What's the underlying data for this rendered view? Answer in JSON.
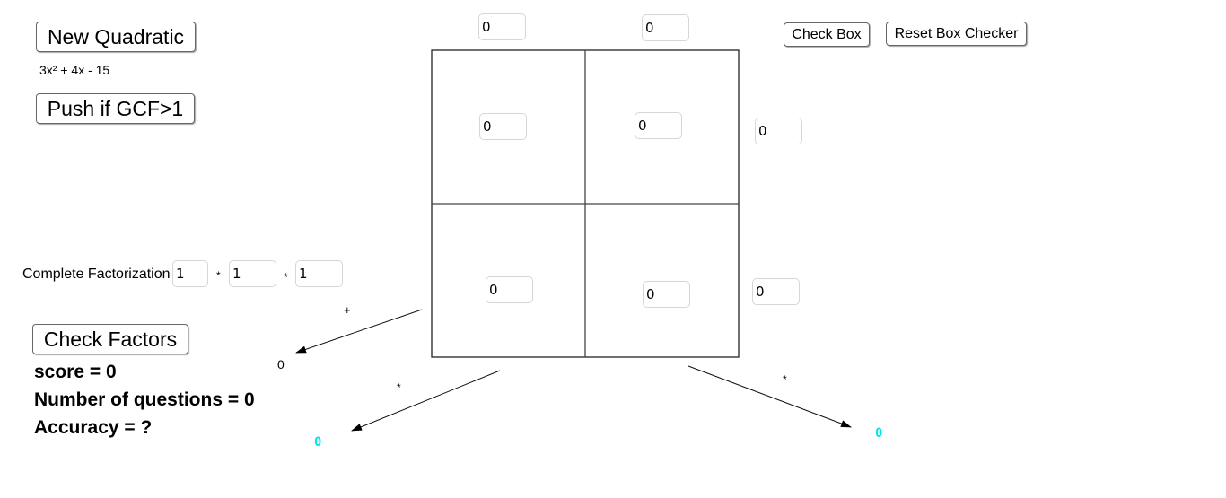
{
  "buttons": {
    "new_quadratic": "New Quadratic",
    "push_gcf": "Push if GCF>1",
    "check_box": "Check Box",
    "reset_box_checker": "Reset Box Checker",
    "check_factors": "Check Factors"
  },
  "quadratic": {
    "expression": "3x² + 4x - 15"
  },
  "box": {
    "top_factors": [
      "0",
      "0"
    ],
    "side_factors": [
      "0",
      "0"
    ],
    "cells": {
      "top_left": "0",
      "top_right": "0",
      "bottom_left": "0",
      "bottom_right": "0"
    }
  },
  "factorization": {
    "label": "Complete Factorization",
    "values": [
      "1",
      "1",
      "1"
    ],
    "operator": "*"
  },
  "arrows": {
    "sum_operator": "+",
    "sum_result": "0",
    "product_left_operator": "*",
    "product_left_result": "0",
    "product_right_operator": "*",
    "product_right_result": "0"
  },
  "stats": {
    "score": "score = 0",
    "questions": "Number of questions = 0",
    "accuracy": "Accuracy = ?"
  },
  "colors": {
    "result_highlight": "#00e5ee"
  }
}
